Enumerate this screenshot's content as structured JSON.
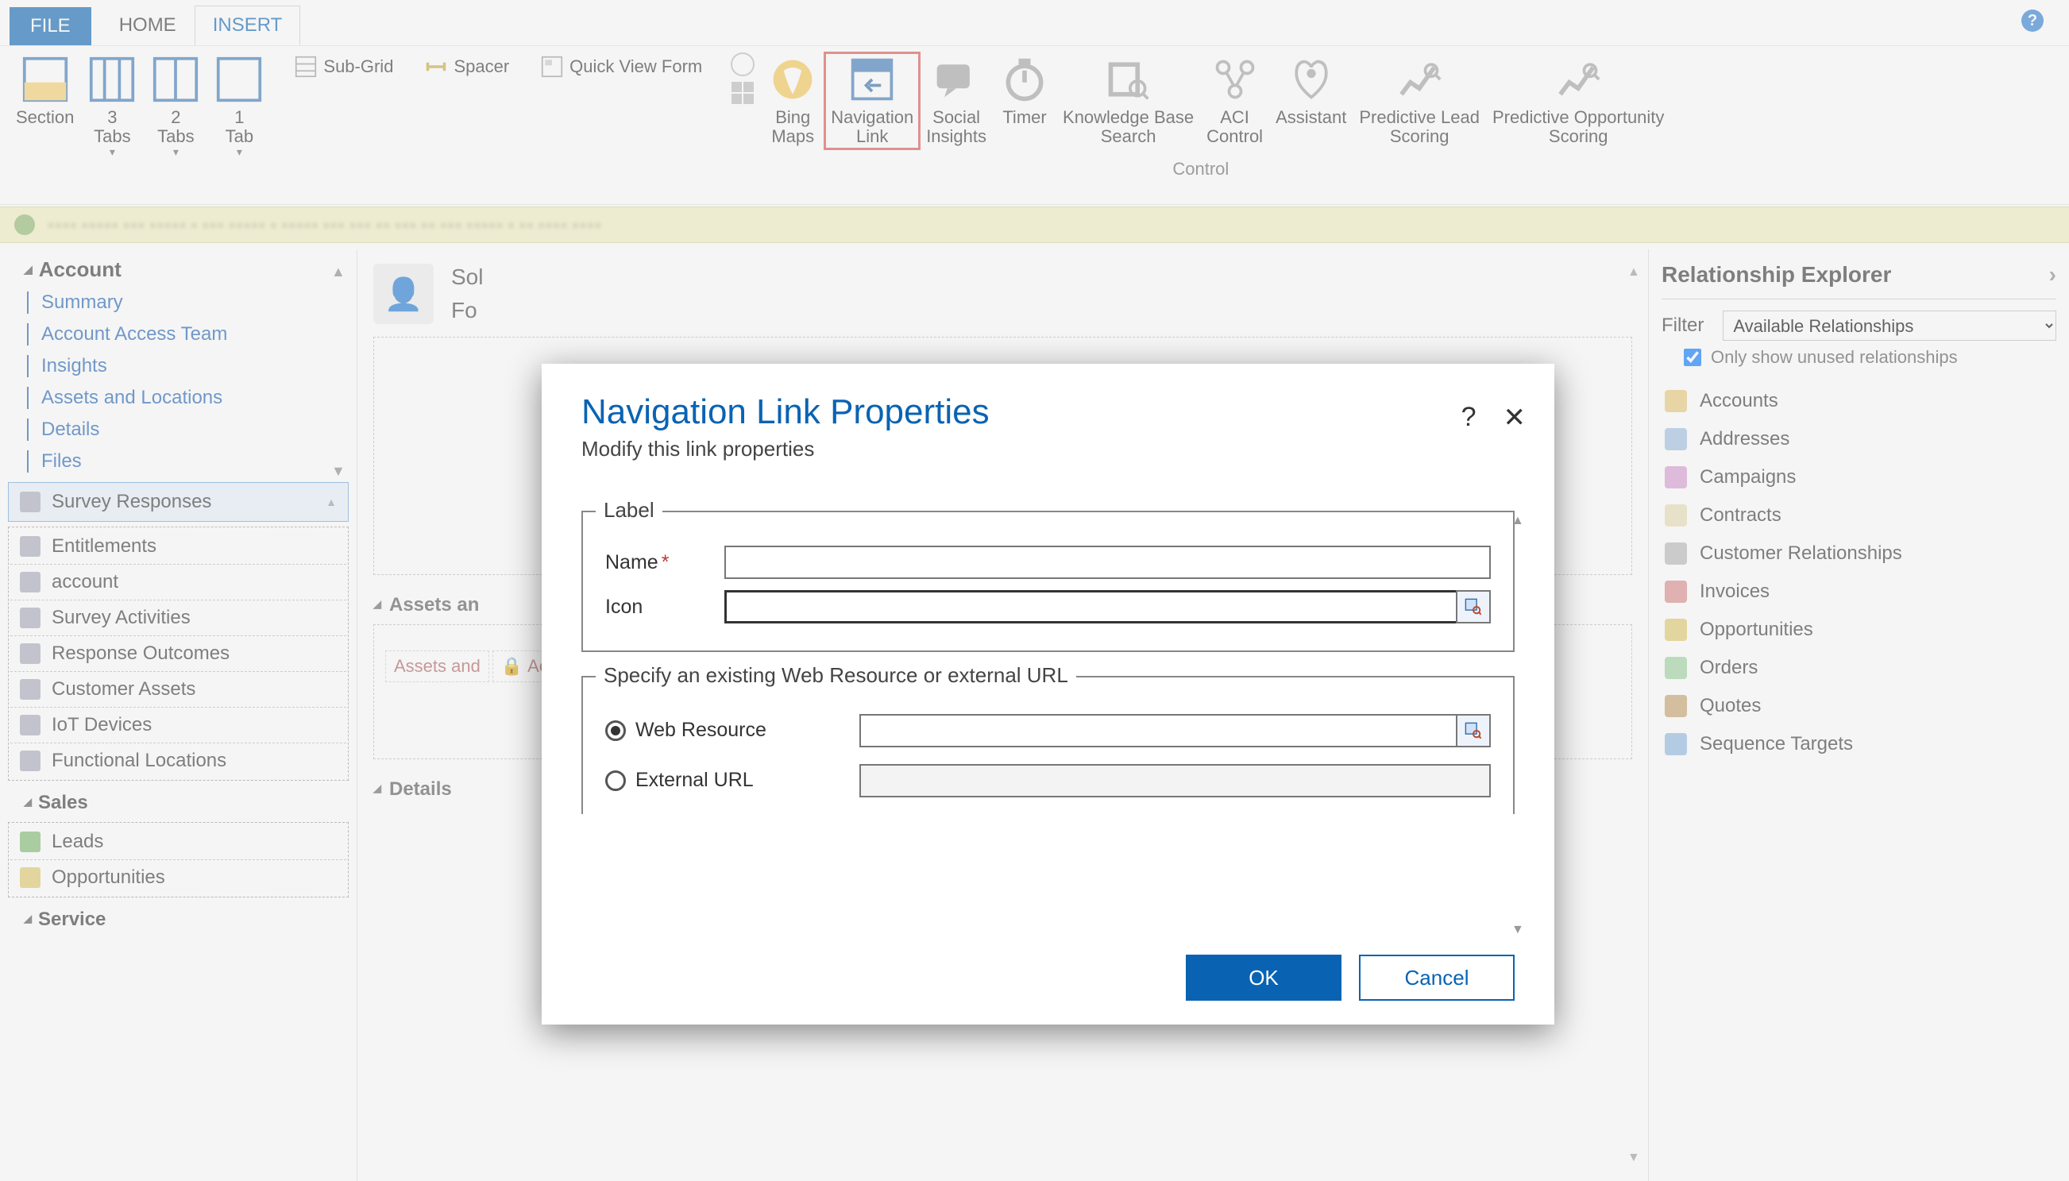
{
  "tabs": {
    "file": "FILE",
    "home": "HOME",
    "insert": "INSERT"
  },
  "ribbon": {
    "section": "Section",
    "tabs3": "3\nTabs",
    "tabs2": "2\nTabs",
    "tab1": "1\nTab",
    "subgrid": "Sub-Grid",
    "spacer": "Spacer",
    "quickview": "Quick View Form",
    "bingmaps": "Bing\nMaps",
    "navlink": "Navigation\nLink",
    "social": "Social\nInsights",
    "timer": "Timer",
    "kb": "Knowledge Base\nSearch",
    "aci": "ACI\nControl",
    "assistant": "Assistant",
    "predlead": "Predictive Lead\nScoring",
    "predopp": "Predictive Opportunity\nScoring",
    "group_control": "Control"
  },
  "left": {
    "root": "Account",
    "items": [
      "Summary",
      "Account Access Team",
      "Insights",
      "Assets and Locations",
      "Details",
      "Files"
    ],
    "nav_survey": "Survey Responses",
    "nav_list": [
      "Entitlements",
      "account",
      "Survey Activities",
      "Response Outcomes",
      "Customer Assets",
      "IoT Devices",
      "Functional Locations"
    ],
    "sales_label": "Sales",
    "sales_items": [
      "Leads",
      "Opportunities"
    ],
    "service_label": "Service"
  },
  "center": {
    "solution_prefix": "Sol",
    "form_prefix": "Fo",
    "section_assets": "Assets an",
    "sub_assets": "Assets and",
    "locked_label": "Accoun",
    "section_details": "Details"
  },
  "right": {
    "title": "Relationship Explorer",
    "filter_label": "Filter",
    "filter_value": "Available Relationships",
    "only_unused": "Only show unused relationships",
    "items": [
      "Accounts",
      "Addresses",
      "Campaigns",
      "Contracts",
      "Customer Relationships",
      "Invoices",
      "Opportunities",
      "Orders",
      "Quotes",
      "Sequence Targets"
    ]
  },
  "dialog": {
    "title": "Navigation Link Properties",
    "subtitle": "Modify this link properties",
    "fs_label": "Label",
    "name_label": "Name",
    "icon_label": "Icon",
    "fs_spec": "Specify an existing Web Resource or external URL",
    "webres": "Web Resource",
    "exturl": "External URL",
    "ok": "OK",
    "cancel": "Cancel"
  }
}
